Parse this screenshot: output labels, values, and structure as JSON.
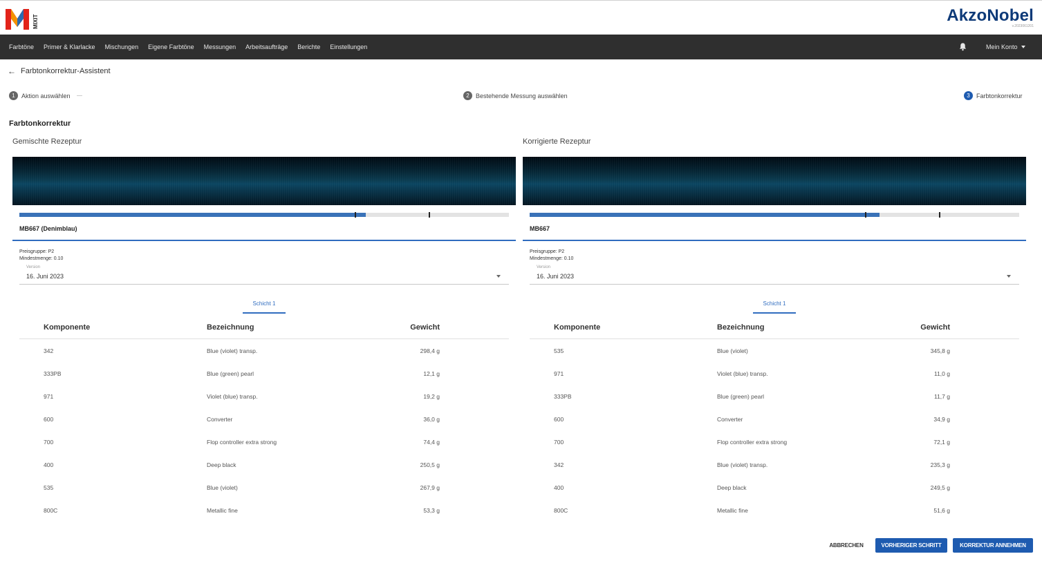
{
  "app": {
    "logo_text": "MIXIT",
    "brand": "AkzoNobel",
    "brand_sub": "v.2023061201",
    "colors": {
      "nav_bg": "#2f2f2f",
      "accent": "#1e5bb0",
      "brand": "#0e3a78"
    }
  },
  "nav": {
    "items": [
      "Farbtöne",
      "Primer & Klarlacke",
      "Mischungen",
      "Eigene Farbtöne",
      "Messungen",
      "Arbeitsaufträge",
      "Berichte",
      "Einstellungen"
    ],
    "bell_icon": "bell-icon",
    "account_label": "Mein Konto"
  },
  "breadcrumb": {
    "title": "Farbtonkorrektur-Assistent"
  },
  "steps": [
    {
      "num": "1",
      "label": "Aktion auswählen",
      "active": false
    },
    {
      "num": "2",
      "label": "Bestehende Messung auswählen",
      "active": false
    },
    {
      "num": "3",
      "label": "Farbtonkorrektur",
      "active": true
    }
  ],
  "section_title": "Farbtonkorrektur",
  "panels": [
    {
      "title": "Gemischte Rezeptur",
      "bar_progress_percent": 70.7,
      "bar_tick_marks_percent": [
        68.5,
        83.6
      ],
      "color_name": "MB667 (Denimblau)",
      "price_group": "Preisgruppe:  P2",
      "min_quantity": "Mindestmenge:  0.10",
      "version_label": "Version",
      "version_value": "16. Juni 2023",
      "layer_tab": "Schicht 1",
      "columns": [
        "Komponente",
        "Bezeichnung",
        "Gewicht"
      ],
      "rows": [
        [
          "342",
          "Blue (violet) transp.",
          "298,4 g"
        ],
        [
          "333PB",
          "Blue (green) pearl",
          "12,1 g"
        ],
        [
          "971",
          "Violet (blue) transp.",
          "19,2 g"
        ],
        [
          "600",
          "Converter",
          "36,0 g"
        ],
        [
          "700",
          "Flop controller extra strong",
          "74,4 g"
        ],
        [
          "400",
          "Deep black",
          "250,5 g"
        ],
        [
          "535",
          "Blue (violet)",
          "267,9 g"
        ],
        [
          "800C",
          "Metallic fine",
          "53,3 g"
        ]
      ]
    },
    {
      "title": "Korrigierte Rezeptur",
      "bar_progress_percent": 71.5,
      "bar_tick_marks_percent": [
        68.5,
        83.6
      ],
      "color_name": "MB667",
      "price_group": "Preisgruppe:  P2",
      "min_quantity": "Mindestmenge:  0.10",
      "version_label": "Version",
      "version_value": "16. Juni 2023",
      "layer_tab": "Schicht 1",
      "columns": [
        "Komponente",
        "Bezeichnung",
        "Gewicht"
      ],
      "rows": [
        [
          "535",
          "Blue (violet)",
          "345,8 g"
        ],
        [
          "971",
          "Violet (blue) transp.",
          "11,0 g"
        ],
        [
          "333PB",
          "Blue (green) pearl",
          "11,7 g"
        ],
        [
          "600",
          "Converter",
          "34,9 g"
        ],
        [
          "700",
          "Flop controller extra strong",
          "72,1 g"
        ],
        [
          "342",
          "Blue (violet) transp.",
          "235,3 g"
        ],
        [
          "400",
          "Deep black",
          "249,5 g"
        ],
        [
          "800C",
          "Metallic fine",
          "51,6 g"
        ]
      ]
    }
  ],
  "actions": {
    "cancel": "ABBRECHEN",
    "previous": "VORHERIGER SCHRITT",
    "accept": "KORREKTUR ANNEHMEN"
  }
}
